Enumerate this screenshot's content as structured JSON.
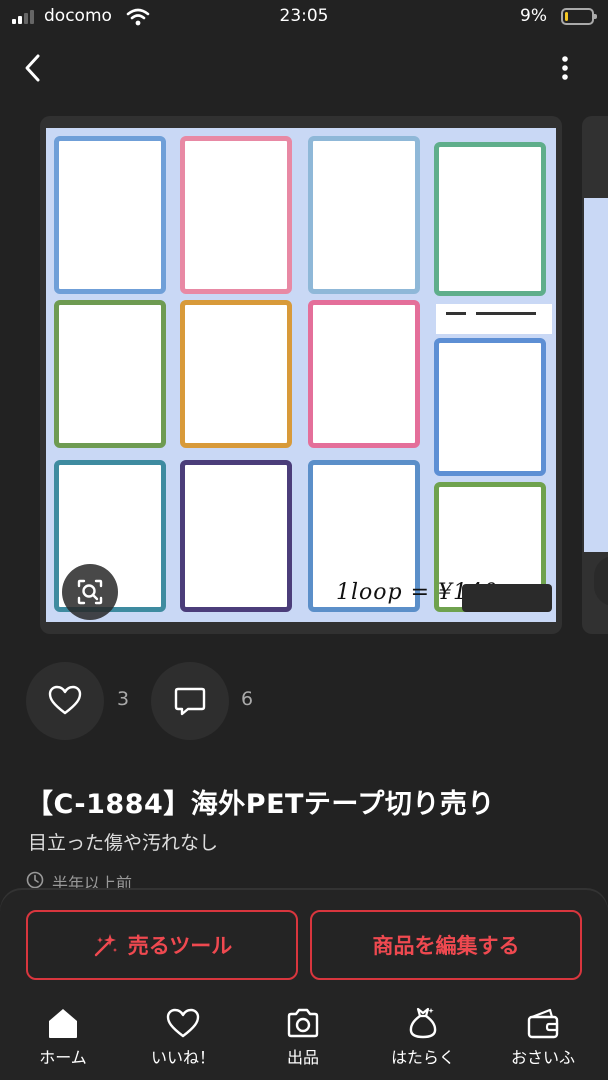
{
  "status_bar": {
    "carrier": "docomo",
    "time": "23:05",
    "battery_percent": "9%",
    "battery_level": 0.09,
    "battery_color": "#f3c623"
  },
  "nav": {
    "back_icon": "chevron-left-icon",
    "menu_icon": "more-vertical-icon"
  },
  "gallery": {
    "image_caption": "1loop = ¥140",
    "zoom_icon": "zoom-scan-icon"
  },
  "actions": {
    "like_count": "3",
    "comment_count": "6"
  },
  "item": {
    "title": "【C-1884】海外PETテープ切り売り",
    "condition": "目立った傷や汚れなし",
    "posted": "半年以上前"
  },
  "buttons": {
    "sell_tool_label": "売るツール",
    "edit_label": "商品を編集する",
    "accent_color": "#ef4950"
  },
  "tabbar": {
    "items": [
      {
        "label": "ホーム",
        "icon": "home-icon"
      },
      {
        "label": "いいね！",
        "icon": "heart-icon"
      },
      {
        "label": "出品",
        "icon": "camera-icon"
      },
      {
        "label": "はたらく",
        "icon": "money-bag-icon"
      },
      {
        "label": "おさいふ",
        "icon": "wallet-icon"
      }
    ]
  }
}
